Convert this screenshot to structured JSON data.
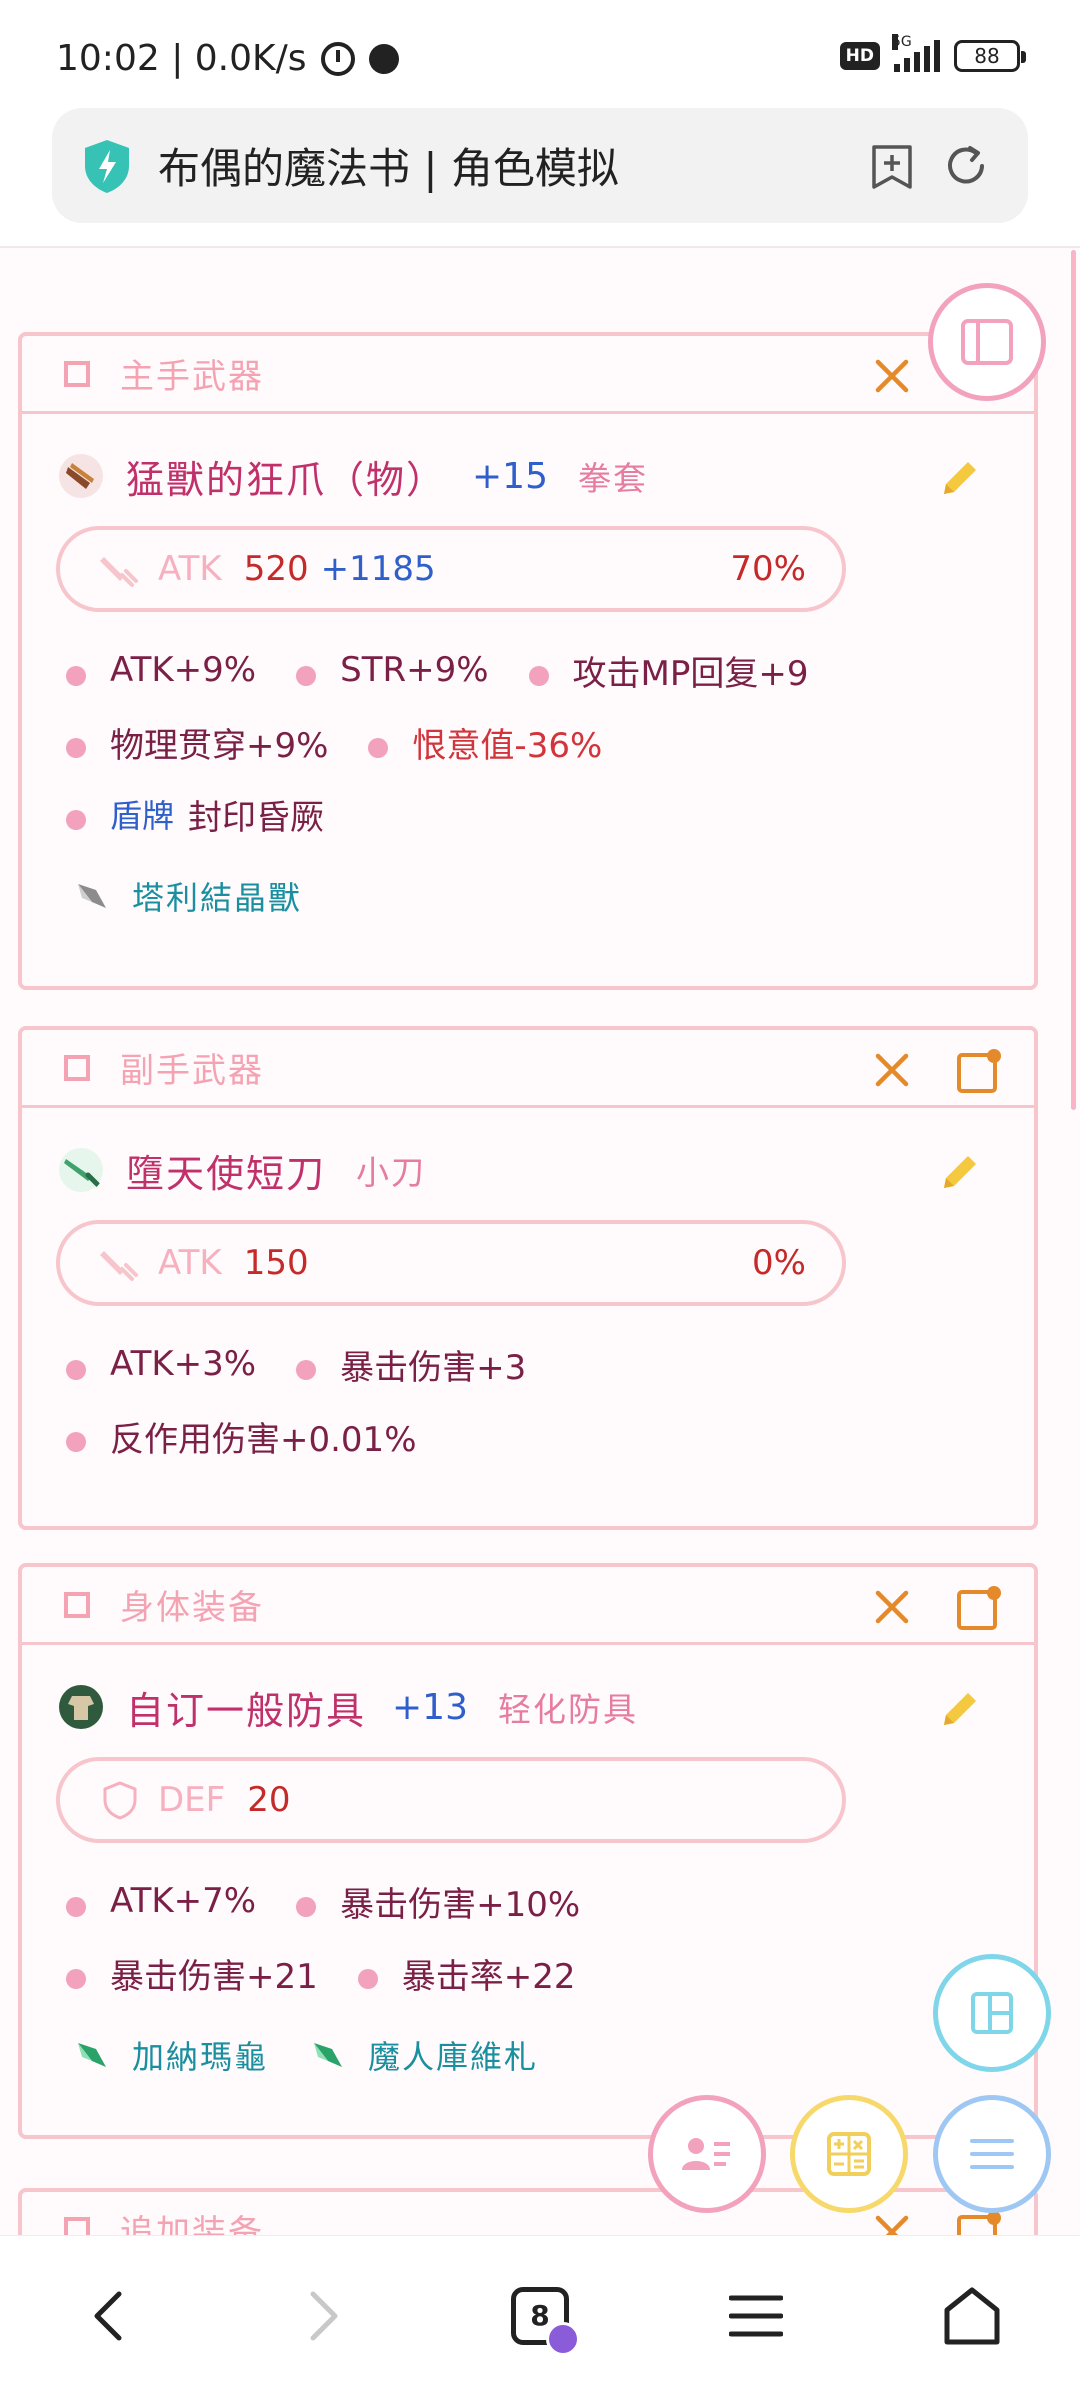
{
  "status_bar": {
    "time_speed": "10:02 | 0.0K/s",
    "hd": "HD",
    "network": "5G",
    "battery": "88"
  },
  "browser": {
    "page_title": "布偶的魔法书 | 角色模拟",
    "tab_count": "8"
  },
  "equipment": {
    "main_weapon": {
      "header": "主手武器",
      "name": "猛獸的狂爪（物）",
      "refine": "+15",
      "type": "拳套",
      "stat_label": "ATK",
      "stat_base": "520",
      "stat_bonus": "+1185",
      "stat_pct": "70%",
      "attrs_line1": [
        "ATK+9%",
        "STR+9%",
        "攻击MP回复+9"
      ],
      "attrs_line2": [
        "物理贯穿+9%",
        "恨意值-36%"
      ],
      "attrs_line3_tag": "盾牌",
      "attrs_line3_value": "封印昏厥",
      "crystals": [
        "塔利結晶獸"
      ]
    },
    "sub_weapon": {
      "header": "副手武器",
      "name": "墮天使短刀",
      "type": "小刀",
      "stat_label": "ATK",
      "stat_base": "150",
      "stat_pct": "0%",
      "attrs_line1": [
        "ATK+3%",
        "暴击伤害+3"
      ],
      "attrs_line2": [
        "反作用伤害+0.01%"
      ]
    },
    "body_armor": {
      "header": "身体装备",
      "name": "自订一般防具",
      "refine": "+13",
      "type": "轻化防具",
      "stat_label": "DEF",
      "stat_base": "20",
      "attrs_line1": [
        "ATK+7%",
        "暴击伤害+10%"
      ],
      "attrs_line2": [
        "暴击伤害+21",
        "暴击率+22"
      ],
      "crystals": [
        "加納瑪龜",
        "魔人庫維札"
      ]
    },
    "additional": {
      "header": "追加装备"
    }
  },
  "colors": {
    "accent_pink": "#f2a2bd",
    "name_color": "#c0306a",
    "refine_blue": "#2f5fcb",
    "value_red": "#c42a2a"
  }
}
